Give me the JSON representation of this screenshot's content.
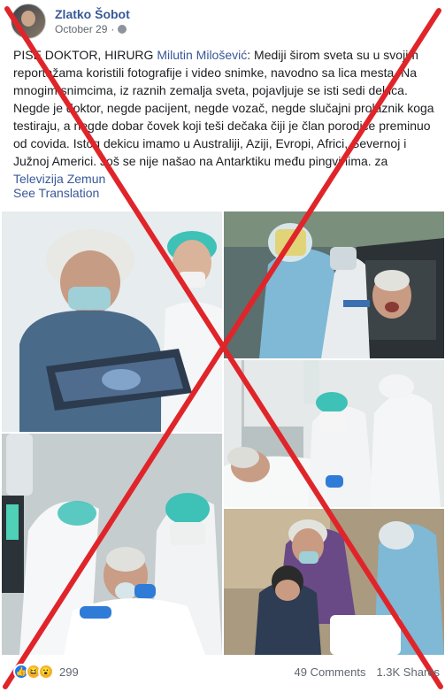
{
  "post": {
    "author": "Zlatko Šobot",
    "date": "October 29",
    "privacy_icon": "globe-icon",
    "text_line1_prefix": "PISE DOKTOR, HIRURG ",
    "text_mention": "Milutin Milošević",
    "text_body": ": Mediji širom sveta su u svojim reportažama koristili fotografije i video snimke, navodno sa lica mesta. Na mnogim snimcima, iz raznih zemalja sveta, pojavljuje se isti sedi dekica. Negde je doktor, negde pacijent, negde vozač, negde slučajni prolaznik koga testiraju, a negde dobar čovek koji teši dečaka čiji je član porodice preminuo od covida. Istog dekicu imamo u Australiji, Aziji, Evropi, Africi, Severnoj i Južnoj Americi. Još se nije našao na Antarktiku među pingvinima. za ",
    "text_link": "Televizija Zemun",
    "see_translation": "See Translation"
  },
  "photos": [
    {
      "name": "photo-doctor-xray"
    },
    {
      "name": "photo-car-test"
    },
    {
      "name": "photo-patient-bed"
    },
    {
      "name": "photo-patient-oxygen"
    },
    {
      "name": "photo-boy-crying"
    }
  ],
  "overlay": {
    "color": "#e0252a"
  },
  "footer": {
    "reaction_icons": [
      "like-icon",
      "haha-icon",
      "wow-icon"
    ],
    "reaction_count": "299",
    "comments": "49 Comments",
    "shares": "1.3K Shares"
  }
}
